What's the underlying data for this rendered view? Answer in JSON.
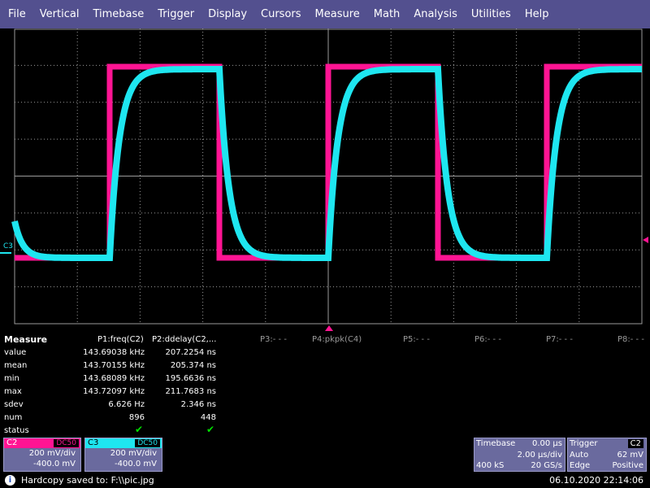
{
  "menu": [
    "File",
    "Vertical",
    "Timebase",
    "Trigger",
    "Display",
    "Cursors",
    "Measure",
    "Math",
    "Analysis",
    "Utilities",
    "Help"
  ],
  "scope": {
    "channel_marker_label": "C3",
    "colors": {
      "c2": "#ff1493",
      "c3": "#1ee6f0",
      "grid": "#9a9a9a"
    }
  },
  "measure": {
    "title": "Measure",
    "headers": [
      "P1:freq(C2)",
      "P2:ddelay(C2,...",
      "P3:- - -",
      "P4:pkpk(C4)",
      "P5:- - -",
      "P6:- - -",
      "P7:- - -",
      "P8:- - -"
    ],
    "rows": [
      {
        "label": "value",
        "p1": "143.69038 kHz",
        "p2": "207.2254 ns"
      },
      {
        "label": "mean",
        "p1": "143.70155 kHz",
        "p2": "205.374 ns"
      },
      {
        "label": "min",
        "p1": "143.68089 kHz",
        "p2": "195.6636 ns"
      },
      {
        "label": "max",
        "p1": "143.72097 kHz",
        "p2": "211.7683 ns"
      },
      {
        "label": "sdev",
        "p1": "6.626 Hz",
        "p2": "2.346 ns"
      },
      {
        "label": "num",
        "p1": "896",
        "p2": "448"
      },
      {
        "label": "status",
        "p1": "✔",
        "p2": "✔"
      }
    ]
  },
  "channels": [
    {
      "name": "C2",
      "coupling": "DC50",
      "volts_div": "200 mV/div",
      "offset": "-400.0 mV",
      "color": "#ff1493"
    },
    {
      "name": "C3",
      "coupling": "DC50",
      "volts_div": "200 mV/div",
      "offset": "-400.0 mV",
      "color": "#1ee6f0"
    }
  ],
  "timebase": {
    "title": "Timebase",
    "delay": "0.00 µs",
    "per_div": "2.00 µs/div",
    "samples": "400 kS",
    "rate": "20 GS/s"
  },
  "trigger": {
    "title": "Trigger",
    "source": "C2",
    "mode": "Auto",
    "level": "62 mV",
    "type": "Edge",
    "slope": "Positive"
  },
  "status": {
    "message": "Hardcopy saved to: F:\\\\pic.jpg",
    "datetime": "06.10.2020 22:14:06"
  }
}
